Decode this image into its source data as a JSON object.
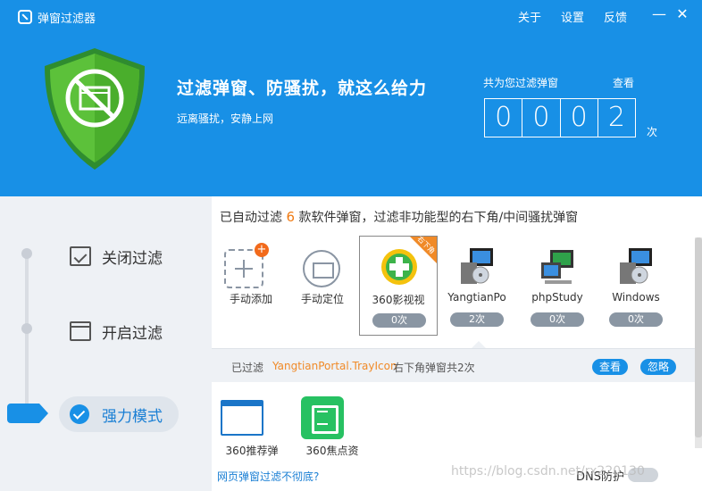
{
  "titlebar": {
    "app_title": "弹窗过滤器",
    "links": [
      "关于",
      "设置",
      "反馈"
    ],
    "minimize": "—",
    "close": "✕"
  },
  "header": {
    "title": "过滤弹窗、防骚扰，就这么给力",
    "subtitle": "远离骚扰，安静上网",
    "counter_label": "共为您过滤弹窗",
    "counter_view": "查看",
    "digits": [
      "0",
      "0",
      "0",
      "2"
    ],
    "unit": "次"
  },
  "sidebar": {
    "items": [
      {
        "label": "关闭过滤"
      },
      {
        "label": "开启过滤"
      },
      {
        "label": "强力模式"
      }
    ]
  },
  "main": {
    "heading_pre": "已自动过滤",
    "heading_num": "6",
    "heading_post": "款软件弹窗，过滤非功能型的右下角/中间骚扰弹窗",
    "items": [
      {
        "label": "手动添加"
      },
      {
        "label": "手动定位"
      },
      {
        "label": "360影视视",
        "count": "0次",
        "ribbon": "右下角"
      },
      {
        "label": "YangtianPo",
        "count": "2次"
      },
      {
        "label": "phpStudy",
        "count": "0次"
      },
      {
        "label": "Windows",
        "count": "0次"
      }
    ],
    "strip": {
      "prefix": "已过滤",
      "name": "YangtianPortal.TrayIcon",
      "suffix": "右下角弹窗共2次",
      "view": "查看",
      "ignore": "忽略"
    },
    "items2": [
      {
        "label": "360推荐弹"
      },
      {
        "label": "360焦点资"
      }
    ],
    "footer_link": "网页弹窗过滤不彻底?",
    "dns_label": "DNS防护"
  },
  "watermark": "https://blog.csdn.net/rx220130",
  "colors": {
    "primary": "#1890e6",
    "orange": "#f07a12",
    "green": "#3aa63f"
  }
}
